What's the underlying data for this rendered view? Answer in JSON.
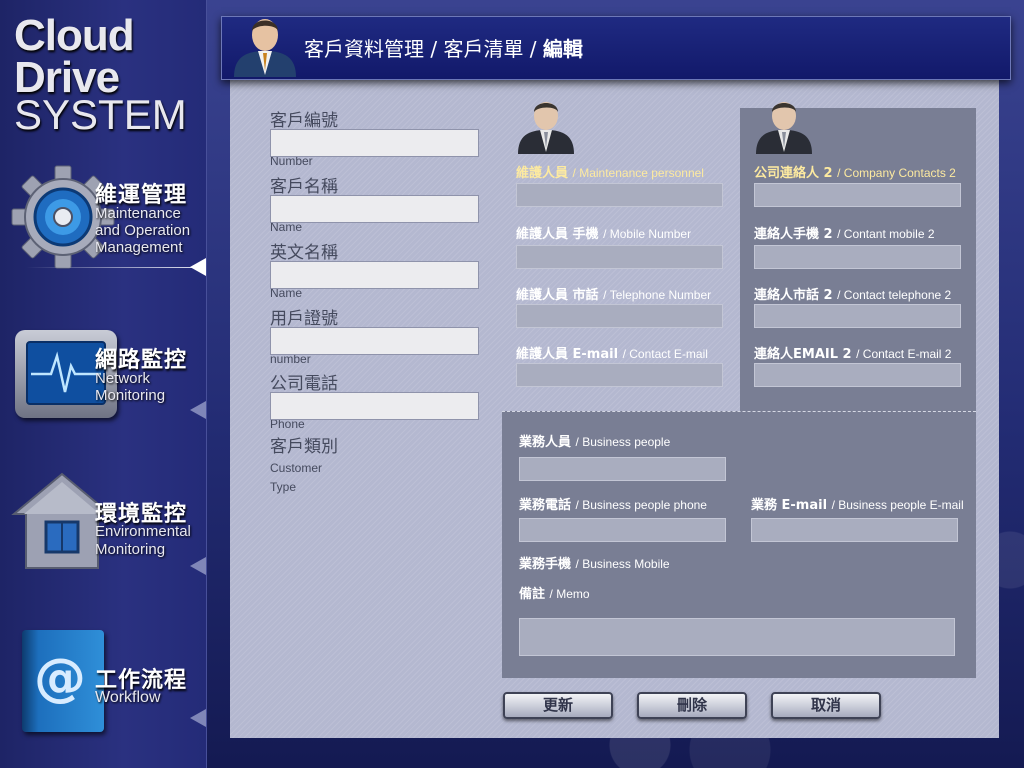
{
  "logo": {
    "line1": "Cloud",
    "line2": "Drive",
    "line3": "SYSTEM"
  },
  "nav": [
    {
      "cn": "維運管理",
      "en1": "Maintenance",
      "en2": "and Operation",
      "en3": "Management",
      "icon": "gear-icon",
      "active": true
    },
    {
      "cn": "網路監控",
      "en1": "Network",
      "en2": "Monitoring",
      "icon": "heartbeat-monitor-icon"
    },
    {
      "cn": "環境監控",
      "en1": "Environmental",
      "en2": "Monitoring",
      "icon": "house-icon"
    },
    {
      "cn": "工作流程",
      "en1": "Workflow",
      "icon": "at-book-icon"
    }
  ],
  "header": {
    "crumb": "客戶資料管理 / 客戶清單 / ",
    "current": "編輯",
    "avatar_icon": "businessman-icon"
  },
  "form": {
    "left": [
      {
        "cn": "客戶編號",
        "en": "Customer Number",
        "value": ""
      },
      {
        "cn": "客戶名稱",
        "en": "Customer Name",
        "value": ""
      },
      {
        "cn": "英文名稱",
        "en": "English Name",
        "value": ""
      },
      {
        "cn": "用戶證號",
        "en": "User card number",
        "value": ""
      },
      {
        "cn": "公司電話",
        "en": "Company Phone",
        "value": ""
      },
      {
        "cn": "客戶類別",
        "en": "Customer Type"
      }
    ],
    "maintenance": [
      {
        "cn": "維護人員",
        "en": "/ Maintenance personnel",
        "value": ""
      },
      {
        "cn": "維護人員 手機",
        "en": " / Mobile Number",
        "value": ""
      },
      {
        "cn": "維護人員 市話",
        "en": "/ Telephone Number",
        "value": ""
      },
      {
        "cn": "維護人員 E-mail",
        "en": "/ Contact E-mail",
        "value": ""
      }
    ],
    "contacts2": [
      {
        "cn": "公司連絡人 2",
        "en": "/ Company Contacts 2",
        "value": ""
      },
      {
        "cn": "連絡人手機 2",
        "en": "/ Contant mobile 2",
        "value": ""
      },
      {
        "cn": "連絡人市話 2",
        "en": "/ Contact telephone 2",
        "value": ""
      },
      {
        "cn": "連絡人EMAIL 2",
        "en": "/ Contact E-mail 2",
        "value": ""
      }
    ],
    "business": {
      "people": {
        "cn": "業務人員",
        "en": "/ Business people",
        "value": ""
      },
      "phone": {
        "cn": "業務電話",
        "en": "/ Business people phone",
        "value": ""
      },
      "email": {
        "cn": "業務 E-mail",
        "en": "/ Business people E-mail",
        "value": ""
      },
      "mobile": {
        "cn": "業務手機",
        "en": "/ Business Mobile"
      },
      "memo": {
        "cn": "備註",
        "en": "/ Memo",
        "value": ""
      }
    }
  },
  "buttons": {
    "update": "更新",
    "delete": "刪除",
    "cancel": "取消"
  },
  "colors": {
    "highlight": "#fdeaa0",
    "panel": "#b4b8d0",
    "dark_box": "#797e94",
    "header": "#1a2274"
  }
}
